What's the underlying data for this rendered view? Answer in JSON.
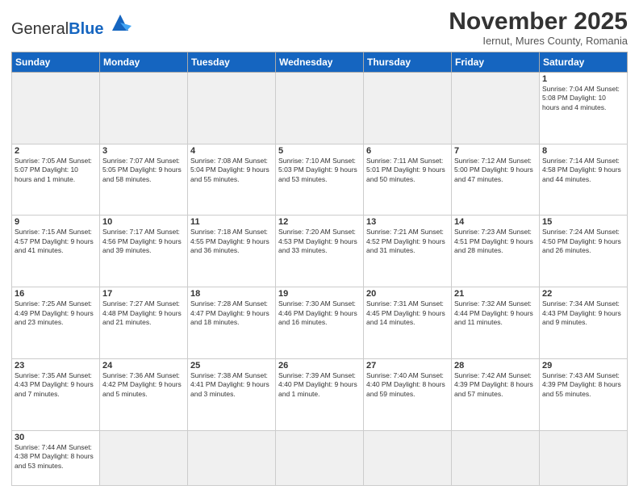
{
  "header": {
    "logo": {
      "general": "General",
      "blue": "Blue"
    },
    "title": "November 2025",
    "subtitle": "Iernut, Mures County, Romania"
  },
  "weekdays": [
    "Sunday",
    "Monday",
    "Tuesday",
    "Wednesday",
    "Thursday",
    "Friday",
    "Saturday"
  ],
  "weeks": [
    [
      {
        "day": null,
        "info": null
      },
      {
        "day": null,
        "info": null
      },
      {
        "day": null,
        "info": null
      },
      {
        "day": null,
        "info": null
      },
      {
        "day": null,
        "info": null
      },
      {
        "day": null,
        "info": null
      },
      {
        "day": "1",
        "info": "Sunrise: 7:04 AM\nSunset: 5:08 PM\nDaylight: 10 hours\nand 4 minutes."
      }
    ],
    [
      {
        "day": "2",
        "info": "Sunrise: 7:05 AM\nSunset: 5:07 PM\nDaylight: 10 hours\nand 1 minute."
      },
      {
        "day": "3",
        "info": "Sunrise: 7:07 AM\nSunset: 5:05 PM\nDaylight: 9 hours\nand 58 minutes."
      },
      {
        "day": "4",
        "info": "Sunrise: 7:08 AM\nSunset: 5:04 PM\nDaylight: 9 hours\nand 55 minutes."
      },
      {
        "day": "5",
        "info": "Sunrise: 7:10 AM\nSunset: 5:03 PM\nDaylight: 9 hours\nand 53 minutes."
      },
      {
        "day": "6",
        "info": "Sunrise: 7:11 AM\nSunset: 5:01 PM\nDaylight: 9 hours\nand 50 minutes."
      },
      {
        "day": "7",
        "info": "Sunrise: 7:12 AM\nSunset: 5:00 PM\nDaylight: 9 hours\nand 47 minutes."
      },
      {
        "day": "8",
        "info": "Sunrise: 7:14 AM\nSunset: 4:58 PM\nDaylight: 9 hours\nand 44 minutes."
      }
    ],
    [
      {
        "day": "9",
        "info": "Sunrise: 7:15 AM\nSunset: 4:57 PM\nDaylight: 9 hours\nand 41 minutes."
      },
      {
        "day": "10",
        "info": "Sunrise: 7:17 AM\nSunset: 4:56 PM\nDaylight: 9 hours\nand 39 minutes."
      },
      {
        "day": "11",
        "info": "Sunrise: 7:18 AM\nSunset: 4:55 PM\nDaylight: 9 hours\nand 36 minutes."
      },
      {
        "day": "12",
        "info": "Sunrise: 7:20 AM\nSunset: 4:53 PM\nDaylight: 9 hours\nand 33 minutes."
      },
      {
        "day": "13",
        "info": "Sunrise: 7:21 AM\nSunset: 4:52 PM\nDaylight: 9 hours\nand 31 minutes."
      },
      {
        "day": "14",
        "info": "Sunrise: 7:23 AM\nSunset: 4:51 PM\nDaylight: 9 hours\nand 28 minutes."
      },
      {
        "day": "15",
        "info": "Sunrise: 7:24 AM\nSunset: 4:50 PM\nDaylight: 9 hours\nand 26 minutes."
      }
    ],
    [
      {
        "day": "16",
        "info": "Sunrise: 7:25 AM\nSunset: 4:49 PM\nDaylight: 9 hours\nand 23 minutes."
      },
      {
        "day": "17",
        "info": "Sunrise: 7:27 AM\nSunset: 4:48 PM\nDaylight: 9 hours\nand 21 minutes."
      },
      {
        "day": "18",
        "info": "Sunrise: 7:28 AM\nSunset: 4:47 PM\nDaylight: 9 hours\nand 18 minutes."
      },
      {
        "day": "19",
        "info": "Sunrise: 7:30 AM\nSunset: 4:46 PM\nDaylight: 9 hours\nand 16 minutes."
      },
      {
        "day": "20",
        "info": "Sunrise: 7:31 AM\nSunset: 4:45 PM\nDaylight: 9 hours\nand 14 minutes."
      },
      {
        "day": "21",
        "info": "Sunrise: 7:32 AM\nSunset: 4:44 PM\nDaylight: 9 hours\nand 11 minutes."
      },
      {
        "day": "22",
        "info": "Sunrise: 7:34 AM\nSunset: 4:43 PM\nDaylight: 9 hours\nand 9 minutes."
      }
    ],
    [
      {
        "day": "23",
        "info": "Sunrise: 7:35 AM\nSunset: 4:43 PM\nDaylight: 9 hours\nand 7 minutes."
      },
      {
        "day": "24",
        "info": "Sunrise: 7:36 AM\nSunset: 4:42 PM\nDaylight: 9 hours\nand 5 minutes."
      },
      {
        "day": "25",
        "info": "Sunrise: 7:38 AM\nSunset: 4:41 PM\nDaylight: 9 hours\nand 3 minutes."
      },
      {
        "day": "26",
        "info": "Sunrise: 7:39 AM\nSunset: 4:40 PM\nDaylight: 9 hours\nand 1 minute."
      },
      {
        "day": "27",
        "info": "Sunrise: 7:40 AM\nSunset: 4:40 PM\nDaylight: 8 hours\nand 59 minutes."
      },
      {
        "day": "28",
        "info": "Sunrise: 7:42 AM\nSunset: 4:39 PM\nDaylight: 8 hours\nand 57 minutes."
      },
      {
        "day": "29",
        "info": "Sunrise: 7:43 AM\nSunset: 4:39 PM\nDaylight: 8 hours\nand 55 minutes."
      }
    ],
    [
      {
        "day": "30",
        "info": "Sunrise: 7:44 AM\nSunset: 4:38 PM\nDaylight: 8 hours\nand 53 minutes."
      },
      {
        "day": null,
        "info": null
      },
      {
        "day": null,
        "info": null
      },
      {
        "day": null,
        "info": null
      },
      {
        "day": null,
        "info": null
      },
      {
        "day": null,
        "info": null
      },
      {
        "day": null,
        "info": null
      }
    ]
  ]
}
